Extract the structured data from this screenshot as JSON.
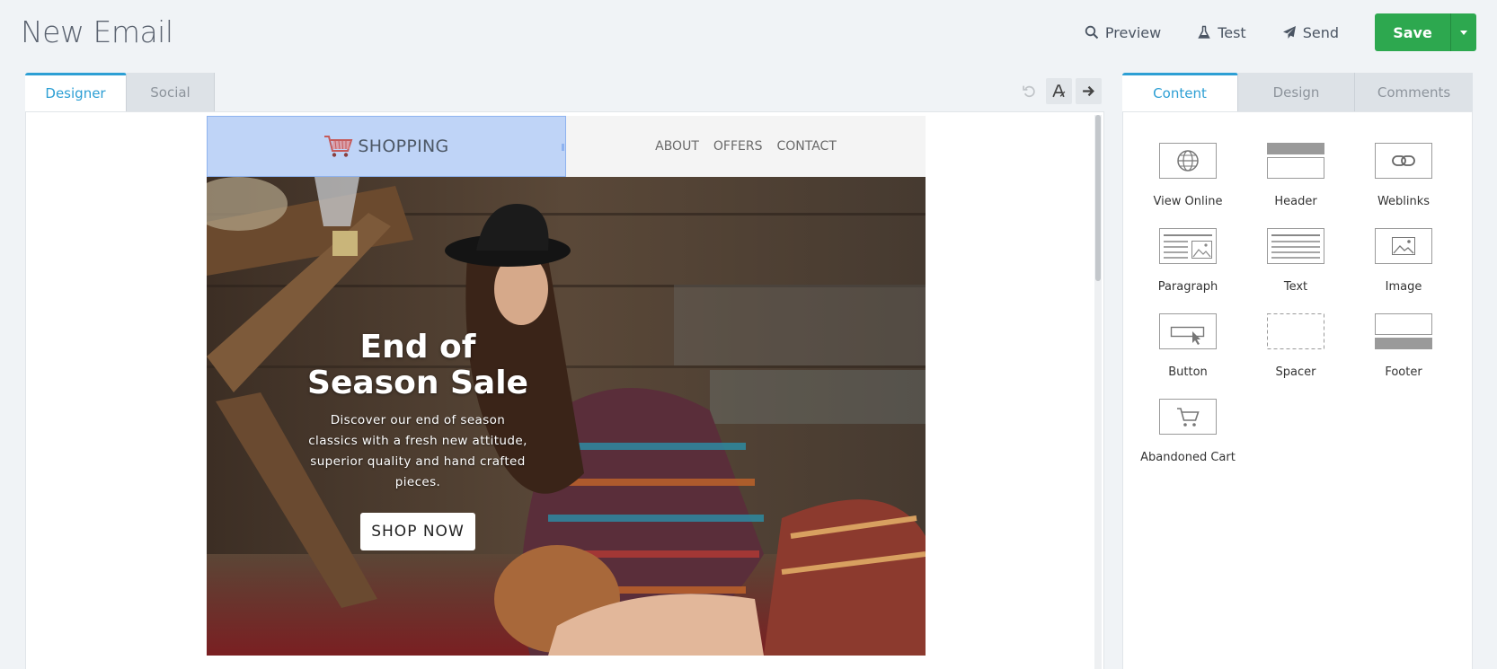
{
  "page": {
    "title": "New Email"
  },
  "actions": {
    "preview": "Preview",
    "test": "Test",
    "send": "Send",
    "save": "Save"
  },
  "editor_tabs": [
    {
      "label": "Designer",
      "active": true
    },
    {
      "label": "Social",
      "active": false
    }
  ],
  "email": {
    "brand": "SHOPPING",
    "nav": [
      "ABOUT",
      "OFFERS",
      "CONTACT"
    ],
    "hero": {
      "title_line1": "End of",
      "title_line2": "Season Sale",
      "description": "Discover our end of season classics with a fresh new attitude, superior quality and hand crafted pieces.",
      "cta": "SHOP NOW"
    }
  },
  "side_tabs": [
    {
      "label": "Content",
      "active": true
    },
    {
      "label": "Design",
      "active": false
    },
    {
      "label": "Comments",
      "active": false
    }
  ],
  "blocks": [
    {
      "label": "View Online",
      "icon": "globe-icon"
    },
    {
      "label": "Header",
      "icon": "header-block-icon"
    },
    {
      "label": "Weblinks",
      "icon": "link-icon"
    },
    {
      "label": "Paragraph",
      "icon": "paragraph-block-icon"
    },
    {
      "label": "Text",
      "icon": "text-block-icon"
    },
    {
      "label": "Image",
      "icon": "image-block-icon"
    },
    {
      "label": "Button",
      "icon": "button-block-icon"
    },
    {
      "label": "Spacer",
      "icon": "spacer-block-icon"
    },
    {
      "label": "Footer",
      "icon": "footer-block-icon"
    },
    {
      "label": "Abandoned Cart",
      "icon": "cart-icon"
    }
  ],
  "colors": {
    "accent": "#2d9fd4",
    "save": "#2da84f",
    "selection": "#bfd4f7"
  }
}
